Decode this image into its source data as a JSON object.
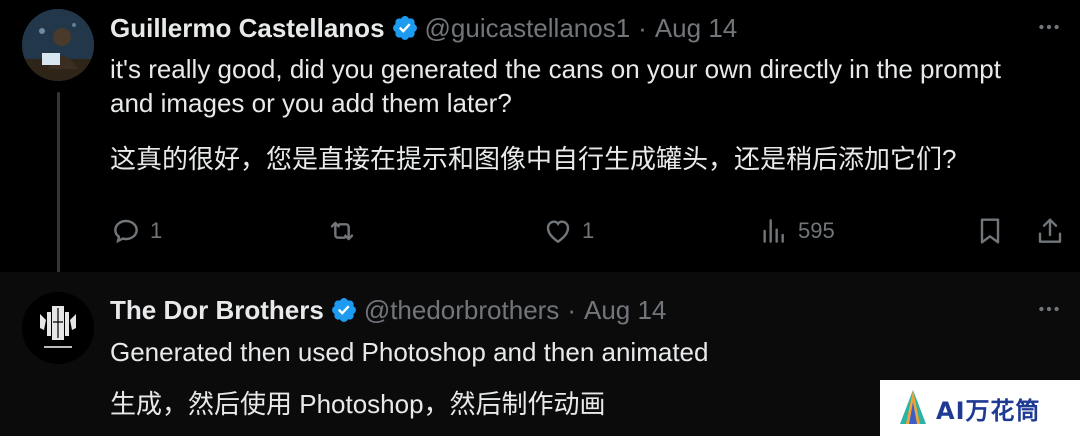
{
  "tweets": [
    {
      "name": "Guillermo Castellanos",
      "handle": "@guicastellanos1",
      "separator": "·",
      "date": "Aug 14",
      "text_en": "it's really good, did you generated the cans on your own directly in the prompt and images or you add them later?",
      "text_zh": "这真的很好，您是直接在提示和图像中自行生成罐头，还是稍后添加它们?",
      "actions": {
        "replies": "1",
        "reposts": "",
        "likes": "1",
        "views": "595"
      }
    },
    {
      "name": "The Dor Brothers",
      "handle": "@thedorbrothers",
      "separator": "·",
      "date": "Aug 14",
      "text_en": "Generated then used Photoshop and then animated",
      "text_zh": "生成，然后使用 Photoshop，然后制作动画"
    }
  ],
  "watermark": {
    "text": "AI万花筒"
  },
  "colors": {
    "background": "#000000",
    "text": "#e7e9ea",
    "muted": "#71767b",
    "verified": "#1d9bf0"
  }
}
